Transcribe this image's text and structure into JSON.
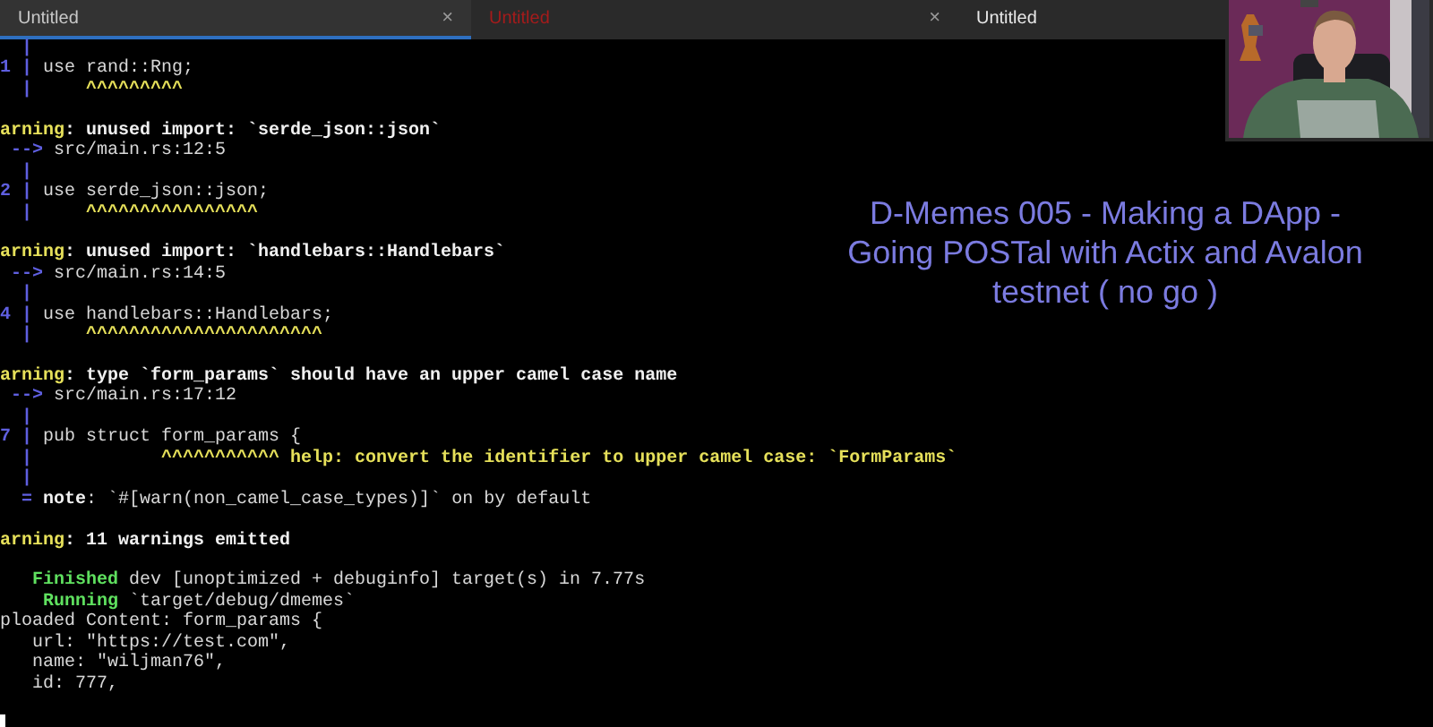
{
  "tabs": [
    {
      "label": "Untitled",
      "selected": true,
      "color": "#c8c8c8",
      "close": "×"
    },
    {
      "label": "Untitled",
      "selected": false,
      "color": "#a51b1b",
      "close": "×"
    },
    {
      "label": "Untitled",
      "selected": false,
      "color": "#e8e8e8"
    }
  ],
  "terminal": {
    "lines": [
      {
        "kind": "text",
        "segments": [
          {
            "kind": "gutter",
            "text": "  |"
          }
        ]
      },
      {
        "kind": "text",
        "segments": [
          {
            "kind": "gutter",
            "text": "1 |"
          },
          {
            "kind": "code",
            "text": " use rand::Rng;"
          }
        ]
      },
      {
        "kind": "text",
        "segments": [
          {
            "kind": "gutter",
            "text": "  |"
          },
          {
            "kind": "caret",
            "text": "     ^^^^^^^^^"
          }
        ]
      },
      {
        "kind": "blank"
      },
      {
        "kind": "text",
        "segments": [
          {
            "kind": "warn",
            "text": "arning"
          },
          {
            "kind": "bold",
            "text": ": unused import: `serde_json::json`"
          }
        ]
      },
      {
        "kind": "text",
        "segments": [
          {
            "kind": "gutter",
            "text": " -->"
          },
          {
            "kind": "code",
            "text": " src/main.rs:12:5"
          }
        ]
      },
      {
        "kind": "text",
        "segments": [
          {
            "kind": "gutter",
            "text": "  |"
          }
        ]
      },
      {
        "kind": "text",
        "segments": [
          {
            "kind": "gutter",
            "text": "2 |"
          },
          {
            "kind": "code",
            "text": " use serde_json::json;"
          }
        ]
      },
      {
        "kind": "text",
        "segments": [
          {
            "kind": "gutter",
            "text": "  |"
          },
          {
            "kind": "caret",
            "text": "     ^^^^^^^^^^^^^^^^"
          }
        ]
      },
      {
        "kind": "blank"
      },
      {
        "kind": "text",
        "segments": [
          {
            "kind": "warn",
            "text": "arning"
          },
          {
            "kind": "bold",
            "text": ": unused import: `handlebars::Handlebars`"
          }
        ]
      },
      {
        "kind": "text",
        "segments": [
          {
            "kind": "gutter",
            "text": " -->"
          },
          {
            "kind": "code",
            "text": " src/main.rs:14:5"
          }
        ]
      },
      {
        "kind": "text",
        "segments": [
          {
            "kind": "gutter",
            "text": "  |"
          }
        ]
      },
      {
        "kind": "text",
        "segments": [
          {
            "kind": "gutter",
            "text": "4 |"
          },
          {
            "kind": "code",
            "text": " use handlebars::Handlebars;"
          }
        ]
      },
      {
        "kind": "text",
        "segments": [
          {
            "kind": "gutter",
            "text": "  |"
          },
          {
            "kind": "caret",
            "text": "     ^^^^^^^^^^^^^^^^^^^^^^"
          }
        ]
      },
      {
        "kind": "blank"
      },
      {
        "kind": "text",
        "segments": [
          {
            "kind": "warn",
            "text": "arning"
          },
          {
            "kind": "bold",
            "text": ": type `form_params` should have an upper camel case name"
          }
        ]
      },
      {
        "kind": "text",
        "segments": [
          {
            "kind": "gutter",
            "text": " -->"
          },
          {
            "kind": "code",
            "text": " src/main.rs:17:12"
          }
        ]
      },
      {
        "kind": "text",
        "segments": [
          {
            "kind": "gutter",
            "text": "  |"
          }
        ]
      },
      {
        "kind": "text",
        "segments": [
          {
            "kind": "gutter",
            "text": "7 |"
          },
          {
            "kind": "code",
            "text": " pub struct form_params {"
          }
        ]
      },
      {
        "kind": "text",
        "segments": [
          {
            "kind": "gutter",
            "text": "  |"
          },
          {
            "kind": "caret",
            "text": "            ^^^^^^^^^^^"
          },
          {
            "kind": "caret",
            "text": " help: convert the identifier to upper camel case: `FormParams`"
          }
        ]
      },
      {
        "kind": "text",
        "segments": [
          {
            "kind": "gutter",
            "text": "  |"
          }
        ]
      },
      {
        "kind": "text",
        "segments": [
          {
            "kind": "gutter",
            "text": "  ="
          },
          {
            "kind": "bold",
            "text": " note"
          },
          {
            "kind": "code",
            "text": ": `#[warn(non_camel_case_types)]` on by default"
          }
        ]
      },
      {
        "kind": "blank"
      },
      {
        "kind": "text",
        "segments": [
          {
            "kind": "warn",
            "text": "arning"
          },
          {
            "kind": "bold",
            "text": ": 11 warnings emitted"
          }
        ]
      },
      {
        "kind": "blank"
      },
      {
        "kind": "text",
        "segments": [
          {
            "kind": "ok",
            "text": "   Finished"
          },
          {
            "kind": "code",
            "text": " dev [unoptimized + debuginfo] target(s) in 7.77s"
          }
        ]
      },
      {
        "kind": "text",
        "segments": [
          {
            "kind": "ok",
            "text": "    Running"
          },
          {
            "kind": "code",
            "text": " `target/debug/dmemes`"
          }
        ]
      },
      {
        "kind": "text",
        "segments": [
          {
            "kind": "code",
            "text": "ploaded Content: form_params {"
          }
        ]
      },
      {
        "kind": "text",
        "segments": [
          {
            "kind": "code",
            "text": "   url: \"https://test.com\","
          }
        ]
      },
      {
        "kind": "text",
        "segments": [
          {
            "kind": "code",
            "text": "   name: \"wiljman76\","
          }
        ]
      },
      {
        "kind": "text",
        "segments": [
          {
            "kind": "code",
            "text": "   id: 777,"
          }
        ]
      },
      {
        "kind": "blank"
      }
    ]
  },
  "overlay_title": "D-Memes 005 - Making a DApp - Going POSTal with Actix and Avalon testnet ( no go )"
}
